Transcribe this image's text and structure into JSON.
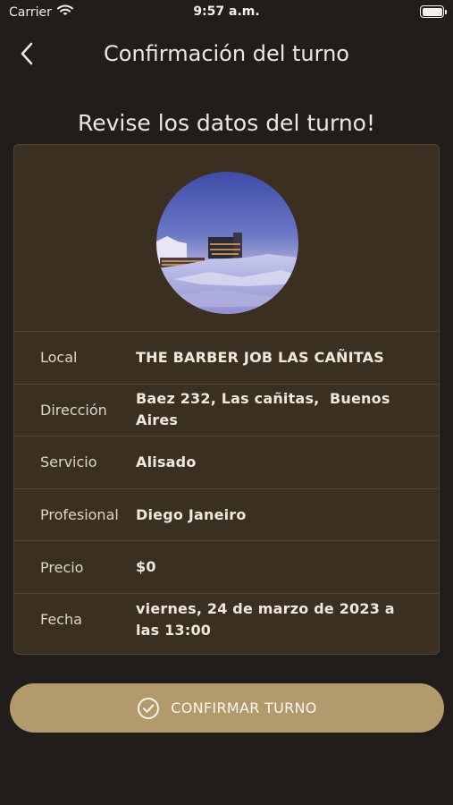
{
  "status_bar": {
    "carrier": "Carrier",
    "time": "9:57 a.m.",
    "battery_level": 1.0
  },
  "nav": {
    "title": "Confirmación del turno",
    "back_icon": "chevron-left-icon"
  },
  "heading": "Revise los datos del turno!",
  "details": [
    {
      "label": "Local",
      "value": "THE BARBER JOB LAS CAÑITAS"
    },
    {
      "label": "Dirección",
      "value": "Baez 232, Las cañitas,  Buenos Aires"
    },
    {
      "label": "Servicio",
      "value": "Alisado"
    },
    {
      "label": "Profesional",
      "value": "Diego Janeiro"
    },
    {
      "label": "Precio",
      "value": "$0"
    },
    {
      "label": "Fecha",
      "value": "viernes, 24 de marzo de 2023 a las 13:00"
    }
  ],
  "confirm_button": {
    "label": "CONFIRMAR TURNO",
    "icon": "check-circle-icon"
  },
  "colors": {
    "background": "#201d1a",
    "card": "#3a2f20",
    "accent": "#b29a6c"
  }
}
